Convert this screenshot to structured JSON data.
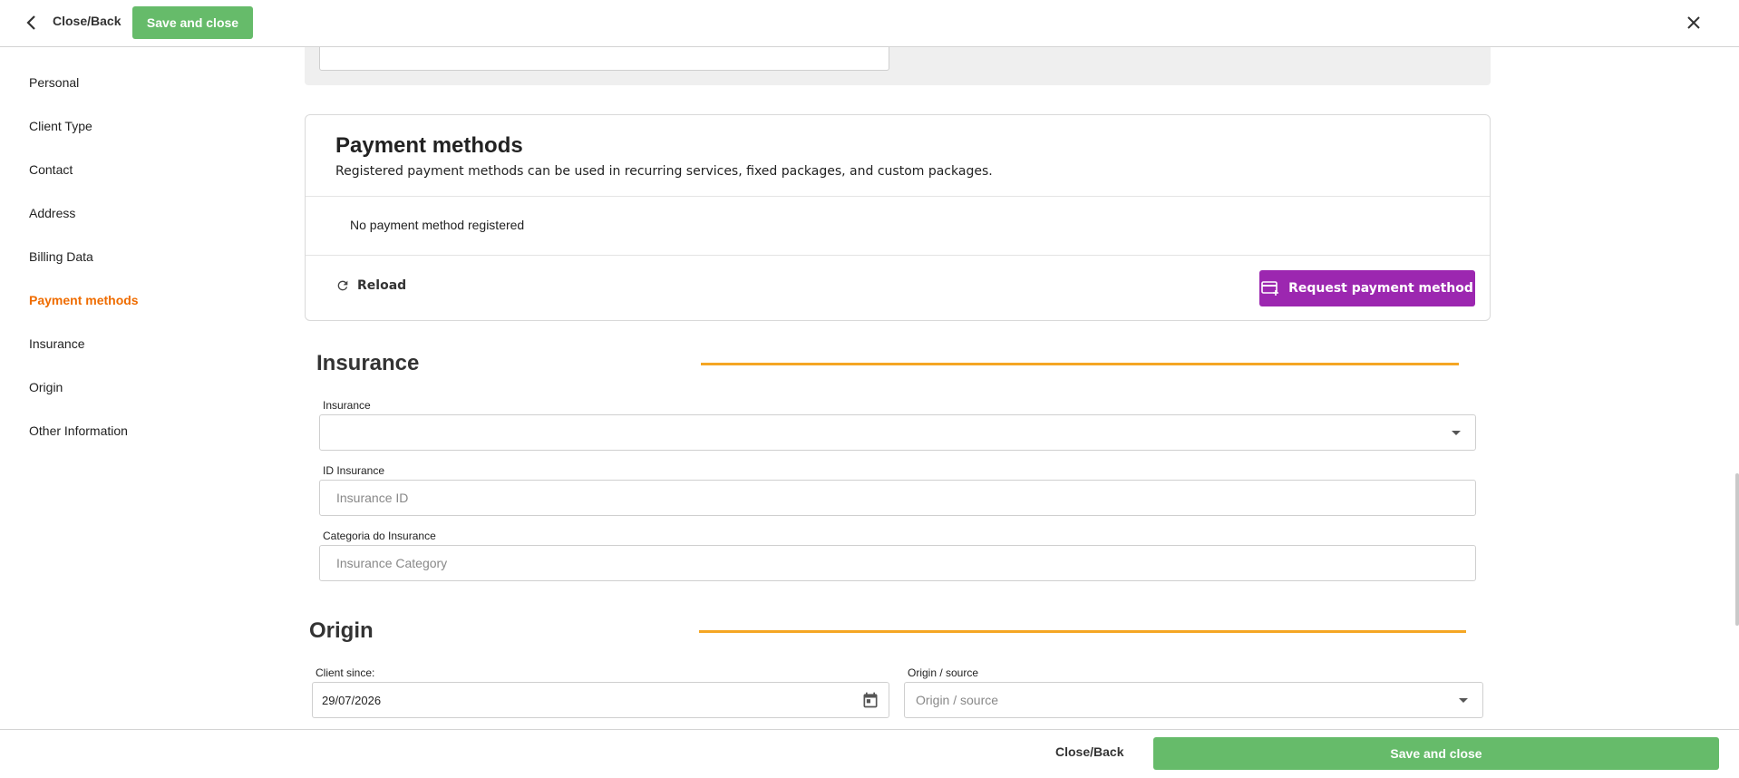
{
  "topbar": {
    "back_icon": "chevron-left-icon",
    "close_back_label": "Close/Back",
    "save_label": "Save and close",
    "close_icon": "close-icon"
  },
  "sidebar": {
    "items": [
      {
        "label": "Personal"
      },
      {
        "label": "Client Type"
      },
      {
        "label": "Contact"
      },
      {
        "label": "Address"
      },
      {
        "label": "Billing Data"
      },
      {
        "label": "Payment methods",
        "active": true
      },
      {
        "label": "Insurance"
      },
      {
        "label": "Origin"
      },
      {
        "label": "Other Information"
      }
    ],
    "active_color": "#ef6c00"
  },
  "payment_methods": {
    "title": "Payment methods",
    "description": "Registered payment methods can be used in recurring services, fixed packages, and custom packages.",
    "empty_text": "No payment method registered",
    "reload_label": "Reload",
    "reload_icon": "refresh-icon",
    "request_label": "Request payment method",
    "request_icon": "credit-card-add-icon",
    "request_color": "#9c27b0"
  },
  "insurance": {
    "title": "Insurance",
    "insurance_label": "Insurance",
    "insurance_value": "",
    "id_label": "ID Insurance",
    "id_placeholder": "Insurance ID",
    "category_label": "Categoria do Insurance",
    "category_placeholder": "Insurance Category"
  },
  "origin": {
    "title": "Origin",
    "client_since_label": "Client since:",
    "client_since_value": "29/07/2026",
    "calendar_icon": "calendar-icon",
    "source_label": "Origin / source",
    "source_placeholder": "Origin / source"
  },
  "bottombar": {
    "close_back_label": "Close/Back",
    "save_label": "Save and close",
    "save_color": "#66bb6a"
  },
  "colors": {
    "section_line": "#f5a623"
  }
}
